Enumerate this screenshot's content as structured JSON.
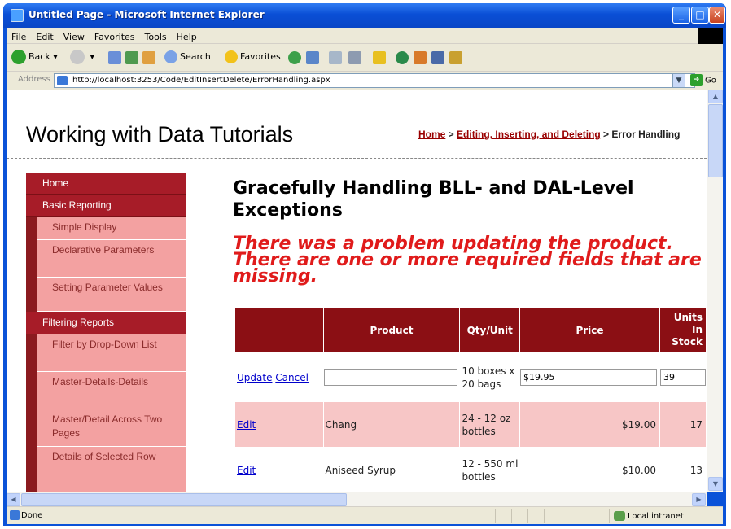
{
  "window": {
    "title": "Untitled Page - Microsoft Internet Explorer",
    "min": "_",
    "max": "□",
    "close": "✕"
  },
  "menubar": [
    "File",
    "Edit",
    "View",
    "Favorites",
    "Tools",
    "Help"
  ],
  "toolbar": {
    "back": "Back",
    "search": "Search",
    "favorites": "Favorites"
  },
  "address": {
    "label": "Address",
    "url": "http://localhost:3253/Code/EditInsertDelete/ErrorHandling.aspx",
    "go": "Go"
  },
  "page": {
    "site_title": "Working with Data Tutorials",
    "breadcrumb": {
      "home": "Home",
      "sep1": " > ",
      "section": "Editing, Inserting, and Deleting",
      "sep2": " > ",
      "current": "Error Handling"
    },
    "heading": "Gracefully Handling BLL- and DAL-Level Exceptions",
    "error": "There was a problem updating the product. There are one or more required fields that are missing.",
    "menu": [
      {
        "label": "Home",
        "type": "top"
      },
      {
        "label": "Basic Reporting",
        "type": "top"
      },
      {
        "label": "Simple Display",
        "type": "sub"
      },
      {
        "label": "Declarative Parameters",
        "type": "sub"
      },
      {
        "label": "Setting Parameter Values",
        "type": "sub"
      },
      {
        "label": "Filtering Reports",
        "type": "top"
      },
      {
        "label": "Filter by Drop-Down List",
        "type": "sub"
      },
      {
        "label": "Master-Details-Details",
        "type": "sub"
      },
      {
        "label": "Master/Detail Across Two Pages",
        "type": "sub"
      },
      {
        "label": "Details of Selected Row",
        "type": "sub"
      }
    ],
    "grid": {
      "headers": [
        "",
        "Product",
        "Qty/Unit",
        "Price",
        "Units In Stock"
      ],
      "edit_row": {
        "update": "Update",
        "cancel": "Cancel",
        "product": "",
        "qty": "10 boxes x 20 bags",
        "price": "$19.95",
        "stock": "39"
      },
      "rows": [
        {
          "action": "Edit",
          "product": "Chang",
          "qty": "24 - 12 oz bottles",
          "price": "$19.00",
          "stock": "17"
        },
        {
          "action": "Edit",
          "product": "Aniseed Syrup",
          "qty": "12 - 550 ml bottles",
          "price": "$10.00",
          "stock": "13"
        }
      ]
    }
  },
  "status": {
    "text": "Done",
    "zone": "Local intranet"
  }
}
